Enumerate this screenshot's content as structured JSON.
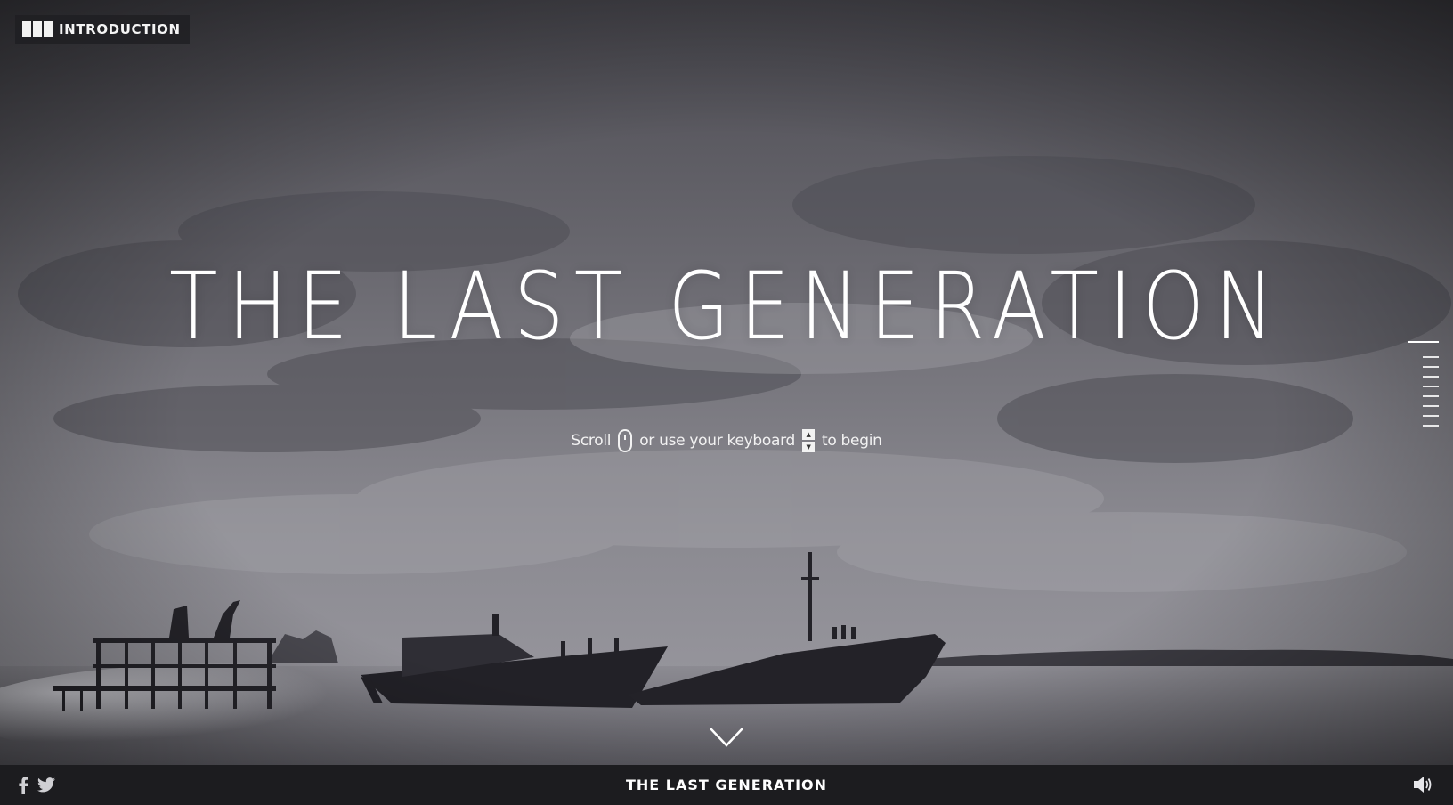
{
  "header": {
    "chapter_label": "INTRODUCTION",
    "menu_icon": "chapters-grid-icon"
  },
  "hero": {
    "title": "THE LAST GENERATION"
  },
  "instructions": {
    "scroll_text": "Scroll",
    "middle_text": "or use your keyboard",
    "end_text": "to begin",
    "mouse_icon": "mouse-icon",
    "keys_icon": "arrow-keys-icon"
  },
  "scroll_nav": {
    "total_sections": 9,
    "active_index": 0
  },
  "footer": {
    "title": "THE LAST GENERATION",
    "icons": [
      "facebook-icon",
      "twitter-icon",
      "speaker-icon"
    ]
  },
  "colors": {
    "overlay_text": "#ffffff",
    "bottom_bar": "#1c1c1f",
    "chapter_button_bg": "#1e1e22"
  }
}
